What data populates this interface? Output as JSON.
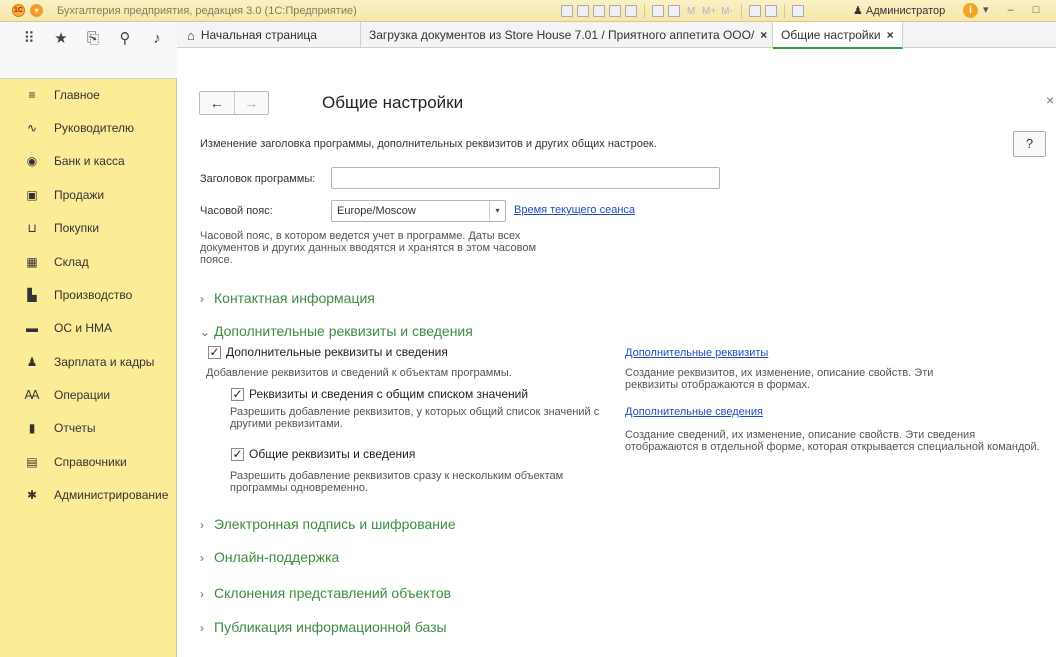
{
  "app": {
    "title": "Бухгалтерия предприятия, редакция 3.0  (1С:Предприятие)",
    "user": "Администратор",
    "m_buttons": [
      "M",
      "M+",
      "M-"
    ]
  },
  "tabs": [
    {
      "label": "Начальная страница"
    },
    {
      "label": "Загрузка документов из Store House 7.01   / Приятного аппетита ООО/",
      "close": "×"
    },
    {
      "label": "Общие настройки",
      "close": "×"
    }
  ],
  "sidebar": {
    "items": [
      {
        "label": "Главное",
        "icon": "≡"
      },
      {
        "label": "Руководителю",
        "icon": "∿"
      },
      {
        "label": "Банк и касса",
        "icon": "◉"
      },
      {
        "label": "Продажи",
        "icon": "▣"
      },
      {
        "label": "Покупки",
        "icon": "⊔"
      },
      {
        "label": "Склад",
        "icon": "▦"
      },
      {
        "label": "Производство",
        "icon": "▙"
      },
      {
        "label": "ОС и НМА",
        "icon": "▬"
      },
      {
        "label": "Зарплата и кадры",
        "icon": "♟"
      },
      {
        "label": "Операции",
        "icon": "Ꜳ"
      },
      {
        "label": "Отчеты",
        "icon": "▮"
      },
      {
        "label": "Справочники",
        "icon": "▤"
      },
      {
        "label": "Администрирование",
        "icon": "✱"
      }
    ]
  },
  "form": {
    "title": "Общие настройки",
    "description": "Изменение заголовка программы, дополнительных реквизитов и других общих настроек.",
    "help_label": "?",
    "program_title_label": "Заголовок программы:",
    "program_title_value": "",
    "timezone_label": "Часовой пояс:",
    "timezone_value": "Europe/Moscow",
    "session_time_link": "Время текущего сеанса",
    "timezone_note": "Часовой пояс, в котором ведется учет в программе. Даты всех документов и других данных вводятся и хранятся в этом часовом поясе."
  },
  "groups": {
    "contact": "Контактная информация",
    "additional": "Дополнительные реквизиты и сведения",
    "signature": "Электронная подпись и шифрование",
    "online": "Онлайн-поддержка",
    "declension": "Склонения представлений объектов",
    "publication": "Публикация информационной базы"
  },
  "additional_section": {
    "cb_main_label": "Дополнительные реквизиты и сведения",
    "cb_main_checked": true,
    "cb_main_note": "Добавление реквизитов и сведений к объектам программы.",
    "cb_common_list_label": "Реквизиты и сведения с общим списком значений",
    "cb_common_list_checked": true,
    "cb_common_list_note": "Разрешить добавление реквизитов, у которых общий список значений с другими реквизитами.",
    "cb_common_label": "Общие реквизиты и сведения",
    "cb_common_checked": true,
    "cb_common_note": "Разрешить добавление реквизитов сразу к нескольким объектам программы одновременно.",
    "link_attrs": "Дополнительные реквизиты",
    "attrs_note": "Создание реквизитов, их изменение, описание свойств. Эти реквизиты отображаются в формах.",
    "link_info": "Дополнительные сведения",
    "info_note": "Создание сведений, их изменение, описание свойств. Эти сведения отображаются в отдельной форме, которая открывается специальной командой."
  }
}
